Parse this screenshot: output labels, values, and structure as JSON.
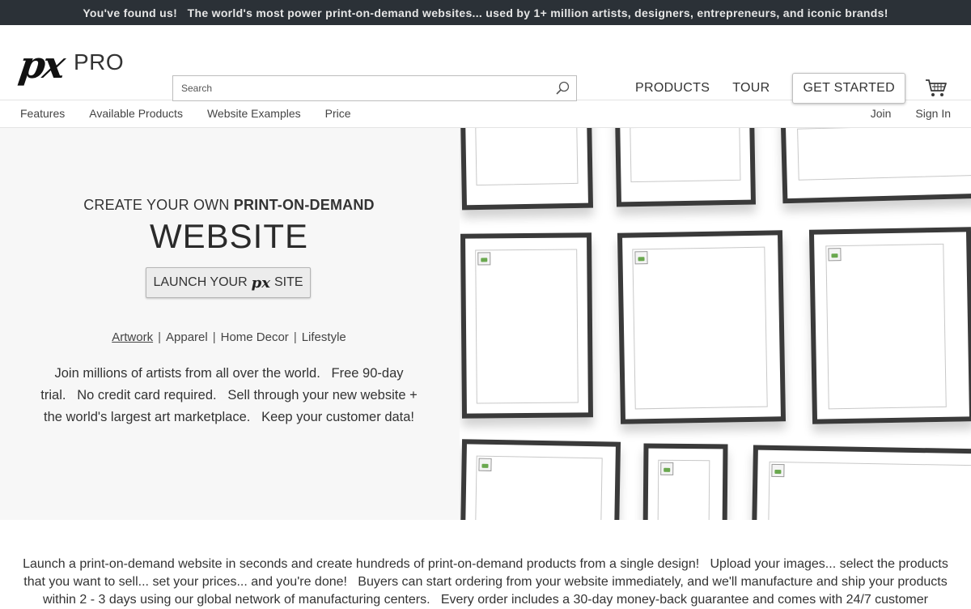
{
  "announcement": "You've found us!   The world's most power print-on-demand websites... used by 1+ million artists, designers, entrepreneurs, and iconic brands!",
  "header": {
    "logo_px": "px",
    "logo_pro": "PRO",
    "search_placeholder": "Search",
    "nav": [
      "PRODUCTS",
      "TOUR"
    ],
    "get_started": "GET STARTED",
    "icons": {
      "search": "magnifier-icon",
      "cart": "shopping-cart-icon"
    }
  },
  "subnav": {
    "left": [
      "Features",
      "Available Products",
      "Website Examples",
      "Price"
    ],
    "right": [
      "Join",
      "Sign In"
    ]
  },
  "hero": {
    "line1_prefix": "CREATE YOUR OWN ",
    "line1_bold": "PRINT-ON-DEMAND",
    "line2": "WEBSITE",
    "launch_prefix": "LAUNCH YOUR",
    "launch_px": "px",
    "launch_suffix": "SITE",
    "categories": [
      "Artwork",
      "Apparel",
      "Home Decor",
      "Lifestyle"
    ],
    "separator": "|",
    "active_category": "Artwork",
    "description": "Join millions of artists from all over the world.   Free 90-day trial.   No credit card required.   Sell through your new website + the world's largest art marketplace.   Keep your customer data!"
  },
  "body_text": "Launch a print-on-demand website in seconds and create hundreds of print-on-demand products from a single design!   Upload your images... select the products that you want to sell... set your prices... and you're done!   Buyers can start ordering from your website immediately, and we'll manufacture and ship your products within 2 - 3 days using our global network of manufacturing centers.   Every order includes a 30-day money-back guarantee and comes with 24/7 customer"
}
